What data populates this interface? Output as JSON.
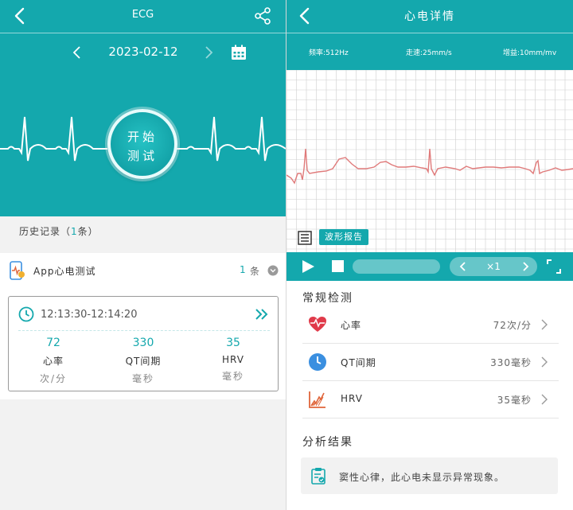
{
  "left": {
    "header_title": "ECG",
    "date": "2023-02-12",
    "start_button": {
      "line1": "开始",
      "line2": "测试"
    },
    "history": {
      "prefix": "历史记录（",
      "count": "1",
      "suffix": "条）"
    },
    "app_row": {
      "name": "App心电测试",
      "count": "1",
      "unit": "条"
    },
    "record": {
      "time_range": "12:13:30-12:14:20",
      "metrics": [
        {
          "value": "72",
          "name": "心率",
          "unit": "次/分"
        },
        {
          "value": "330",
          "name": "QT间期",
          "unit": "毫秒"
        },
        {
          "value": "35",
          "name": "HRV",
          "unit": "毫秒"
        }
      ]
    }
  },
  "right": {
    "header_title": "心电详情",
    "params": {
      "frequency": "频率:512Hz",
      "speed": "走速:25mm/s",
      "gain": "增益:10mm/mv"
    },
    "report_button": "波形报告",
    "playback_speed": "×1",
    "routine_title": "常规检测",
    "rows": [
      {
        "label": "心率",
        "value": "72次/分",
        "icon": "heart-pulse-icon"
      },
      {
        "label": "QT间期",
        "value": "330毫秒",
        "icon": "clock-icon"
      },
      {
        "label": "HRV",
        "value": "35毫秒",
        "icon": "hrv-chart-icon"
      }
    ],
    "analysis_title": "分析结果",
    "analysis_text": "窦性心律，此心电未显示异常现象。"
  },
  "colors": {
    "teal": "#14a8ad",
    "ecg_line": "#e07a7a",
    "heart_red": "#e03a4a",
    "clock_blue": "#3a8fe0",
    "hrv_orange": "#e0653a"
  }
}
